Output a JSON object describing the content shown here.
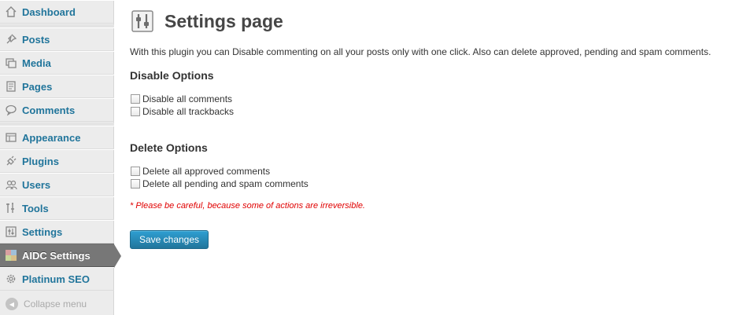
{
  "sidebar": {
    "items": [
      {
        "label": "Dashboard",
        "icon": "home-icon"
      },
      {
        "label": "Posts",
        "icon": "pushpin-icon"
      },
      {
        "label": "Media",
        "icon": "media-icon"
      },
      {
        "label": "Pages",
        "icon": "pages-icon"
      },
      {
        "label": "Comments",
        "icon": "comment-icon"
      },
      {
        "label": "Appearance",
        "icon": "appearance-icon"
      },
      {
        "label": "Plugins",
        "icon": "plugin-icon"
      },
      {
        "label": "Users",
        "icon": "users-icon"
      },
      {
        "label": "Tools",
        "icon": "tools-icon"
      },
      {
        "label": "Settings",
        "icon": "settings-icon"
      },
      {
        "label": "AIDC Settings",
        "icon": "aidc-icon",
        "active": true
      },
      {
        "label": "Platinum SEO",
        "icon": "gear-icon"
      }
    ],
    "collapse_label": "Collapse menu"
  },
  "page": {
    "title": "Settings page",
    "intro": "With this plugin you can Disable commenting on all your posts only with one click. Also can delete approved, pending and spam comments.",
    "disable_section": {
      "title": "Disable Options",
      "options": [
        "Disable all comments",
        "Disable all trackbacks"
      ]
    },
    "delete_section": {
      "title": "Delete Options",
      "options": [
        "Delete all approved comments",
        "Delete all pending and spam comments"
      ]
    },
    "warning": "* Please be careful, because some of actions are irreversible.",
    "save_label": "Save changes"
  },
  "colors": {
    "link": "#21759b",
    "active_menu": "#777777",
    "warning": "#e00000",
    "button": "#21759b"
  }
}
